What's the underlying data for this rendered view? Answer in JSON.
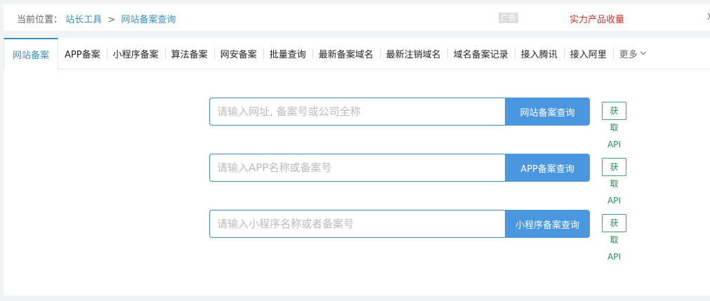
{
  "breadcrumb": {
    "prefix": "当前位置：",
    "items": [
      "站长工具",
      "网站备案查询"
    ],
    "separator": ">"
  },
  "ad": {
    "tag": "广告",
    "text": "实力产品收量",
    "close": "X"
  },
  "tabs": [
    {
      "label": "网站备案",
      "active": true
    },
    {
      "label": "APP备案"
    },
    {
      "label": "小程序备案"
    },
    {
      "label": "算法备案"
    },
    {
      "label": "网安备案"
    },
    {
      "label": "批量查询"
    },
    {
      "label": "最新备案域名"
    },
    {
      "label": "最新注销域名"
    },
    {
      "label": "域名备案记录"
    },
    {
      "label": "接入腾讯"
    },
    {
      "label": "接入阿里"
    },
    {
      "label": "更多"
    }
  ],
  "queries": [
    {
      "placeholder": "请输入网址, 备案号或公司全称",
      "button": "网站备案查询",
      "api": "获取API"
    },
    {
      "placeholder": "请输入APP名称或备案号",
      "button": "APP备案查询",
      "api": "获取API"
    },
    {
      "placeholder": "请输入小程序名称或者备案号",
      "button": "小程序备案查询",
      "api": "获取API"
    }
  ],
  "colors": {
    "accent": "#3c8dbc",
    "button": "#4a97e0",
    "api": "#3aa66f",
    "ad": "#c9302c"
  }
}
